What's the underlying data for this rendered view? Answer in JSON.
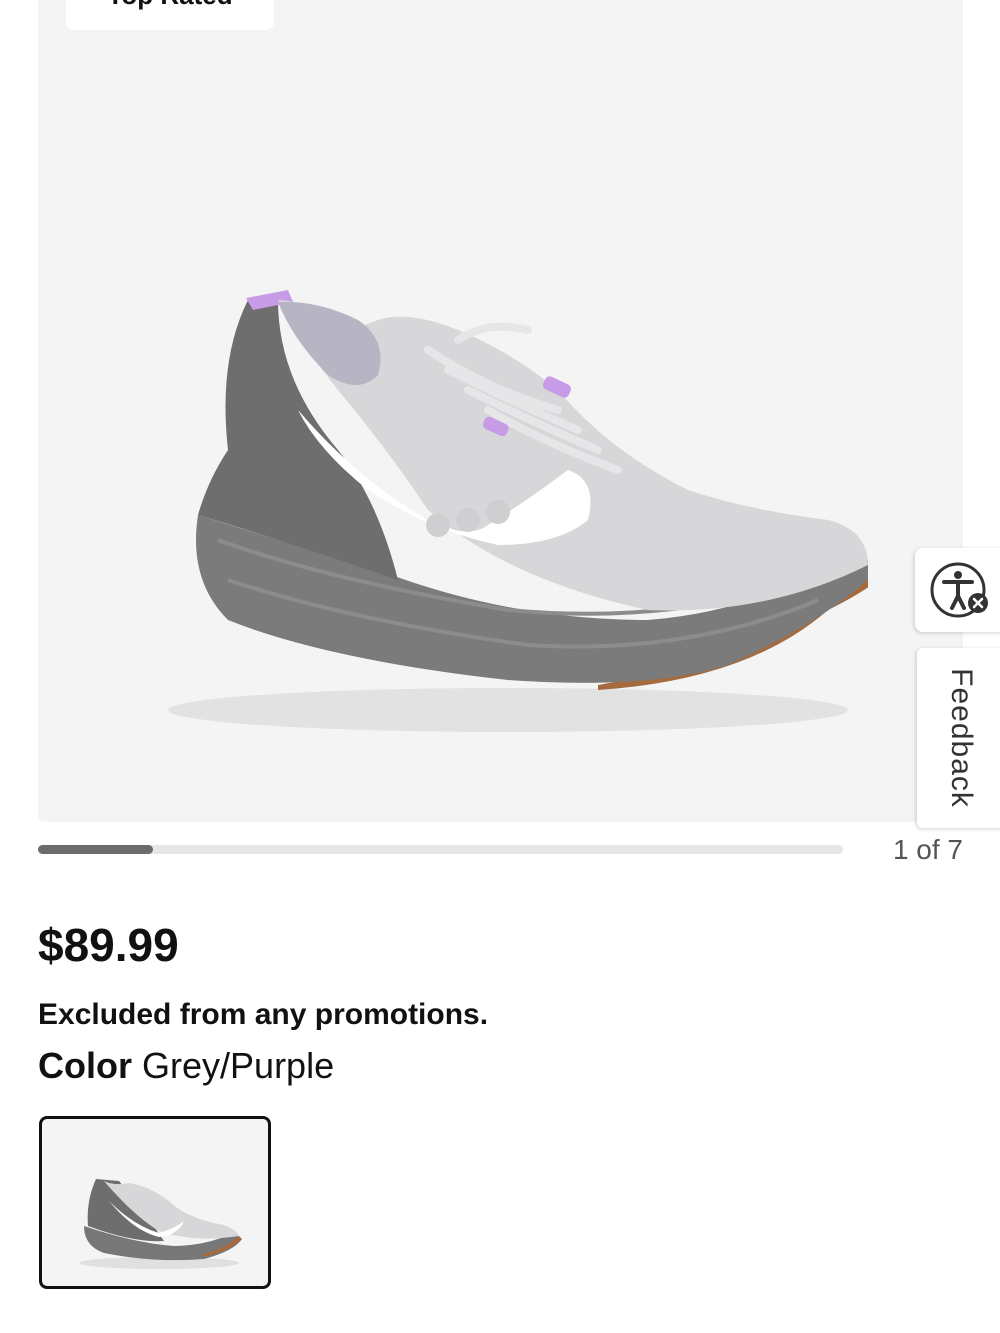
{
  "gallery": {
    "badge": "Top Rated",
    "image_alt": "Grey/Purple running shoe",
    "counter": "1 of 7",
    "progress": 0.143
  },
  "product": {
    "price": "$89.99",
    "promo_note": "Excluded from any promotions.",
    "color_label": "Color",
    "color_value": "Grey/Purple"
  },
  "swatches": [
    {
      "name": "Grey/Purple",
      "selected": true
    }
  ],
  "side_widgets": {
    "accessibility_icon": "accessibility-icon",
    "feedback_label": "Feedback"
  },
  "colors": {
    "accent_dark": "#111111",
    "gallery_bg": "#f4f4f4",
    "progress_fill": "#6b6b6b",
    "progress_track": "#e6e6e6"
  }
}
